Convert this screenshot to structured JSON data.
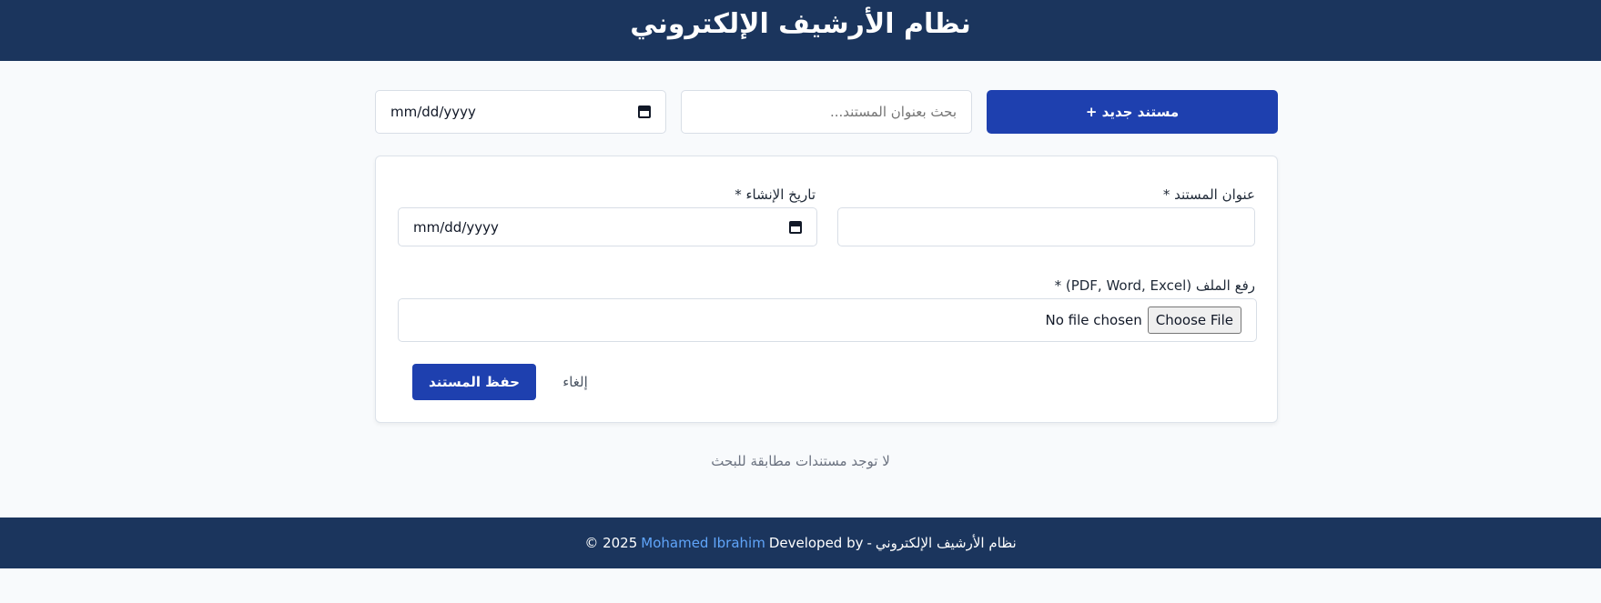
{
  "header": {
    "title": "نظام الأرشيف الإلكتروني"
  },
  "toolbar": {
    "new_button_label": "مستند جديد +",
    "search_placeholder": "بحث بعنوان المستند...",
    "date_filter_value": "mm/dd/yyyy"
  },
  "form": {
    "title_label": "عنوان المستند *",
    "date_label": "تاريخ الإنشاء *",
    "date_value": "mm/dd/yyyy",
    "file_label": "رفع الملف (PDF, Word, Excel) *",
    "choose_file_label": "Choose File",
    "file_status": "No file chosen",
    "save_label": "حفظ المستند",
    "cancel_label": "إلغاء"
  },
  "results": {
    "empty_message": "لا توجد مستندات مطابقة للبحث"
  },
  "footer": {
    "year_text": "© 2025",
    "author": "Mohamed Ibrahim",
    "developed_by": "Developed by",
    "separator": "-",
    "system_name": "نظام الأرشيف الإلكتروني"
  },
  "colors": {
    "header_bg": "#1b355d",
    "primary": "#1e40af",
    "link": "#60a5fa",
    "page_bg": "#f8fafc"
  },
  "icons": {
    "calendar": "calendar-icon"
  }
}
